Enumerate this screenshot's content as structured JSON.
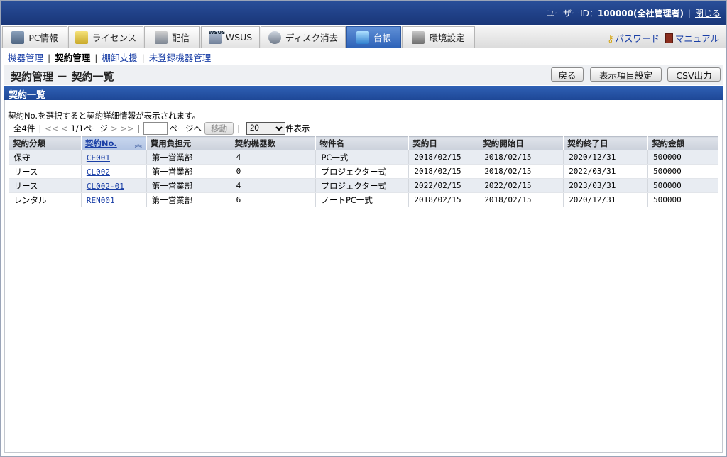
{
  "header": {
    "user_label": "ユーザーID：",
    "user_id": "100000(全社管理者)",
    "close_label": "閉じる"
  },
  "tabs": [
    {
      "label": "PC情報",
      "icon": "pc-icon"
    },
    {
      "label": "ライセンス",
      "icon": "license-icon"
    },
    {
      "label": "配信",
      "icon": "distribution-icon"
    },
    {
      "label": "WSUS",
      "icon": "wsus-icon",
      "icon_caption": "WSUS"
    },
    {
      "label": "ディスク消去",
      "icon": "disk-erase-icon"
    },
    {
      "label": "台帳",
      "icon": "ledger-icon",
      "active": true
    },
    {
      "label": "環境設定",
      "icon": "settings-tools-icon"
    }
  ],
  "tab_links": {
    "password": "パスワード",
    "manual": "マニュアル"
  },
  "subnav": {
    "items": [
      "機器管理",
      "契約管理",
      "棚卸支援",
      "未登録機器管理"
    ],
    "current": "契約管理"
  },
  "page": {
    "title": "契約管理 － 契約一覧",
    "buttons": {
      "back": "戻る",
      "columns": "表示項目設定",
      "csv": "CSV出力"
    }
  },
  "section_title": "契約一覧",
  "note": "契約No.を選択すると契約詳細情報が表示されます。",
  "pager": {
    "total": "全4件",
    "first": "<<",
    "prev": "<",
    "page_info": "1/1ページ",
    "next": ">",
    "last": ">>",
    "page_input": "",
    "page_suffix": "ページへ",
    "move": "移動",
    "per_page": "20",
    "per_page_suffix": "件表示"
  },
  "table": {
    "columns": [
      "契約分類",
      "契約No.",
      "費用負担元",
      "契約機器数",
      "物件名",
      "契約日",
      "契約開始日",
      "契約終了日",
      "契約金額"
    ],
    "rows": [
      [
        "保守",
        "CE001",
        "第一営業部",
        "4",
        "PC一式",
        "2018/02/15",
        "2018/02/15",
        "2020/12/31",
        "500000"
      ],
      [
        "リース",
        "CL002",
        "第一営業部",
        "0",
        "プロジェクター式",
        "2018/02/15",
        "2018/02/15",
        "2022/03/31",
        "500000"
      ],
      [
        "リース",
        "CL002-01",
        "第一営業部",
        "4",
        "プロジェクター式",
        "2022/02/15",
        "2022/02/15",
        "2023/03/31",
        "500000"
      ],
      [
        "レンタル",
        "REN001",
        "第一営業部",
        "6",
        "ノートPC一式",
        "2018/02/15",
        "2018/02/15",
        "2020/12/31",
        "500000"
      ]
    ]
  }
}
